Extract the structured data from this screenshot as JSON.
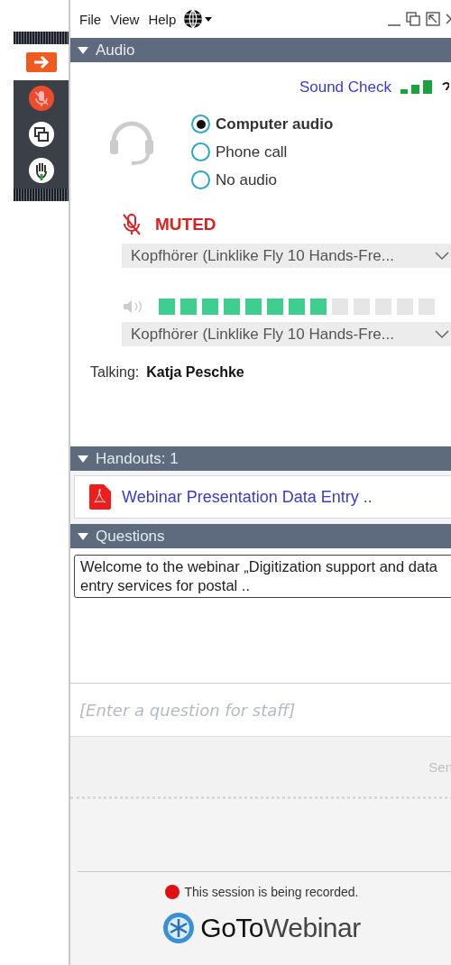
{
  "toolbar": {
    "items": [
      {
        "selected": true
      },
      {
        "selected": false
      },
      {
        "selected": false
      },
      {
        "selected": false
      }
    ]
  },
  "menu": {
    "items": [
      "File",
      "View",
      "Help"
    ]
  },
  "audio": {
    "title": "Audio",
    "expanded": true,
    "sound_check": "Sound Check",
    "options": [
      {
        "label": "Computer audio",
        "selected": true
      },
      {
        "label": "Phone call",
        "selected": false
      },
      {
        "label": "No audio",
        "selected": false
      }
    ],
    "mic": {
      "muted": true,
      "status": "MUTED",
      "device": "Kopfhörer (Linklike Fly 10 Hands-Fre..."
    },
    "speaker": {
      "level": 0.615,
      "device": "Kopfhörer (Linklike Fly 10 Hands-Fre..."
    },
    "talking_label": "Talking:",
    "talking_name": "Katja Peschke"
  },
  "handouts": {
    "title": "Handouts: 1",
    "expanded": true,
    "items": [
      "Webinar Presentation Data Entry .."
    ]
  },
  "questions": {
    "title": "Questions",
    "expanded": true,
    "messages": [
      "Welcome to the webinar „Digitization support and data entry services for postal .."
    ],
    "placeholder": "[Enter a question for staff]",
    "send": "Sen"
  },
  "footer": {
    "recording": "This session is being recorded.",
    "logo": "**GoTo**Webinar"
  }
}
